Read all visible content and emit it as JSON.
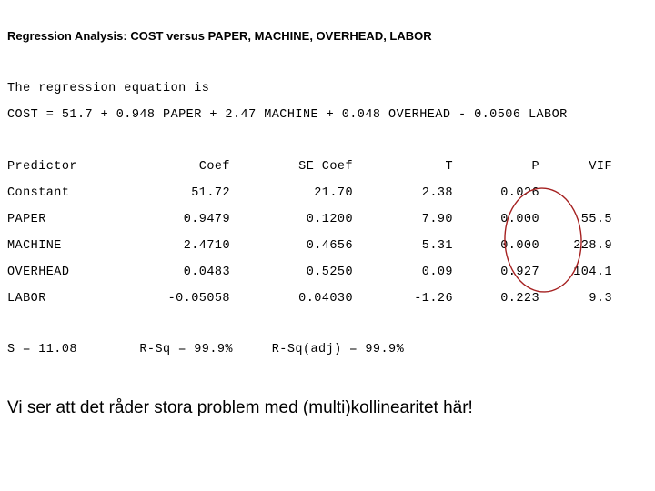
{
  "title": "Regression Analysis: COST versus PAPER, MACHINE, OVERHEAD, LABOR",
  "equation": {
    "intro": "The regression equation is",
    "line": "COST = 51.7 + 0.948 PAPER + 2.47 MACHINE + 0.048 OVERHEAD - 0.0506 LABOR"
  },
  "table": {
    "headers": {
      "predictor": "Predictor",
      "coef": "Coef",
      "se_coef": "SE Coef",
      "t": "T",
      "p": "P",
      "vif": "VIF"
    },
    "rows": [
      {
        "predictor": "Constant",
        "coef": "51.72",
        "se_coef": "21.70",
        "t": "2.38",
        "p": "0.026",
        "vif": ""
      },
      {
        "predictor": "PAPER",
        "coef": "0.9479",
        "se_coef": "0.1200",
        "t": "7.90",
        "p": "0.000",
        "vif": "55.5"
      },
      {
        "predictor": "MACHINE",
        "coef": "2.4710",
        "se_coef": "0.4656",
        "t": "5.31",
        "p": "0.000",
        "vif": "228.9"
      },
      {
        "predictor": "OVERHEAD",
        "coef": "0.0483",
        "se_coef": "0.5250",
        "t": "0.09",
        "p": "0.927",
        "vif": "104.1"
      },
      {
        "predictor": "LABOR",
        "coef": "-0.05058",
        "se_coef": "0.04030",
        "t": "-1.26",
        "p": "0.223",
        "vif": "9.3"
      }
    ]
  },
  "summary": "S = 11.08        R-Sq = 99.9%     R-Sq(adj) = 99.9%",
  "caption": "Vi ser att det råder stora problem med (multi)kollinearitet här!",
  "annotation": {
    "shape": "ellipse",
    "target": "VIF column values",
    "color": "#A52020"
  }
}
